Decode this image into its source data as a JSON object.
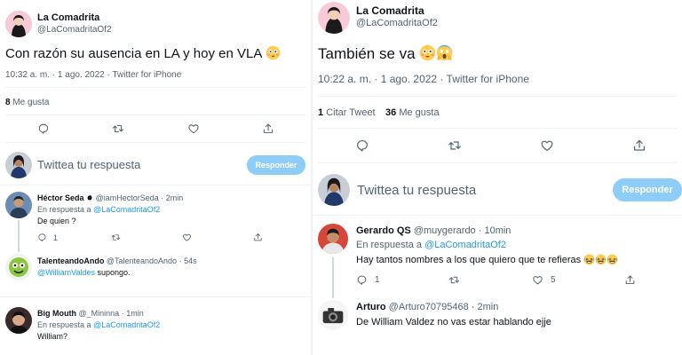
{
  "left": {
    "author": {
      "name": "La Comadrita",
      "handle": "@LaComadritaOf2"
    },
    "tweet_text": "Con razón su ausencia en LA y hoy en VLA",
    "meta": "10:32 a. m. · 1 ago. 2022 · Twitter for iPhone",
    "likes": {
      "count": "8",
      "label": "Me gusta"
    },
    "composer": {
      "placeholder": "Twittea tu respuesta",
      "button": "Responder"
    },
    "replies": [
      {
        "name": "Héctor Seda",
        "handle": "@iamHectorSeda",
        "time": "· 2min",
        "reply_to_label": "En respuesta a",
        "reply_to": "@LaComadritaOf2",
        "text": "De quien ?",
        "reply_count": "1"
      },
      {
        "name": "TalenteandoAndo",
        "handle": "@TalenteandoAndo",
        "time": "· 54s",
        "mention": "@WilliamValdes",
        "text": "supongo."
      },
      {
        "name": "Big Mouth",
        "handle": "@_Mininna",
        "time": "· 1min",
        "reply_to_label": "En respuesta a",
        "reply_to": "@LaComadritaOf2",
        "text": "William?"
      }
    ]
  },
  "right": {
    "author": {
      "name": "La Comadrita",
      "handle": "@LaComadritaOf2"
    },
    "tweet_text": "También se va",
    "meta": "10:22 a. m. · 1 ago. 2022 · Twitter for iPhone",
    "stats": {
      "quotes_count": "1",
      "quotes_label": "Citar Tweet",
      "likes_count": "36",
      "likes_label": "Me gusta"
    },
    "composer": {
      "placeholder": "Twittea tu respuesta",
      "button": "Responder"
    },
    "replies": [
      {
        "name": "Gerardo QS",
        "handle": "@muygerardo",
        "time": "· 10min",
        "reply_to_label": "En respuesta a",
        "reply_to": "@LaComadritaOf2",
        "text": "Hay tantos nombres a los que quiero que te refieras",
        "reply_count": "1",
        "like_count": "5"
      },
      {
        "name": "Arturo",
        "handle": "@Arturo70795468",
        "time": "· 2min",
        "text": "De William Valdez no vas estar hablando ejje"
      }
    ]
  },
  "colors": {
    "accent": "#1d9bf0",
    "muted": "#536471",
    "divider": "#eff3f4",
    "button_disabled": "#8ecdf7"
  },
  "icons": [
    "reply-icon",
    "retweet-icon",
    "like-icon",
    "share-icon",
    "verified-icon",
    "flushed-emoji",
    "scream-emoji",
    "laughing-emoji"
  ]
}
